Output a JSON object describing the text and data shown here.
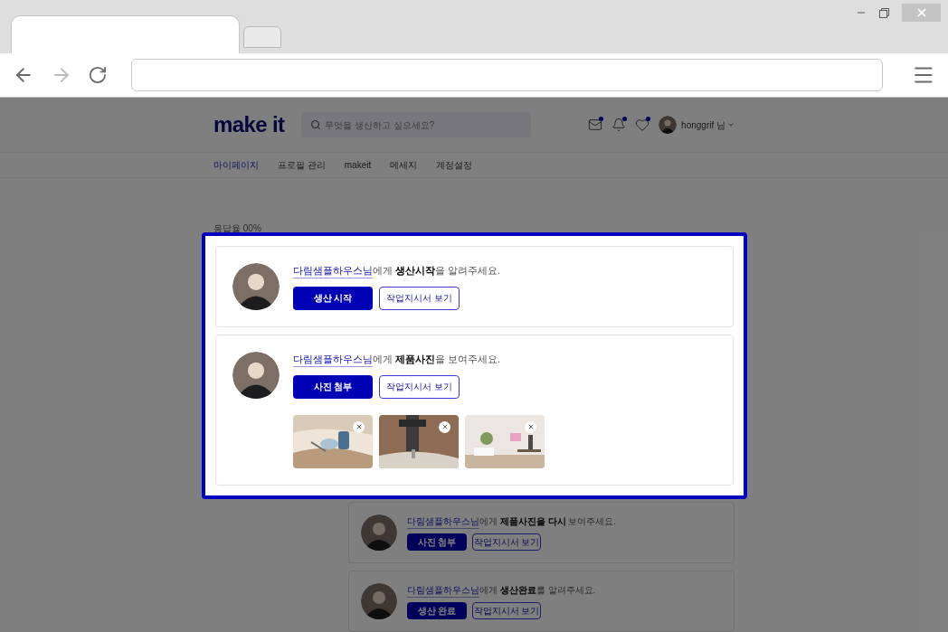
{
  "browser": {
    "tabs": [
      {
        "selected": true
      },
      {
        "selected": false
      }
    ],
    "forward_disabled": true
  },
  "page": {
    "logo": "make it",
    "search": {
      "placeholder": "무엇을 생산하고 싶으세요?"
    },
    "header_icons": [
      {
        "kind": "mail",
        "unread": true
      },
      {
        "kind": "bell",
        "unread": true
      },
      {
        "kind": "heart",
        "unread": true
      }
    ],
    "user": "honggrif 님",
    "nav": [
      {
        "label": "마이페이지",
        "selected": true
      },
      {
        "label": "프로필 관리",
        "selected": false
      },
      {
        "label": "makeit",
        "selected": false
      },
      {
        "label": "메세지",
        "selected": false
      },
      {
        "label": "계정설정",
        "selected": false
      }
    ],
    "response_rate": "응답율 00%",
    "background_tasks": [
      {
        "partner": "다림샘플하우스님",
        "message": "에게 **제품사진을 다시** 보여주세요.",
        "primary": "사진 첨부",
        "secondary": "작업지시서 보기"
      },
      {
        "partner": "다림샘플하우스님",
        "message": "에게 **생산완료**를 알려주세요.",
        "primary": "생산 완료",
        "secondary": "작업지시서 보기"
      }
    ]
  },
  "highlighted_tasks": [
    {
      "partner": "다림샘플하우스님",
      "message": "에게 **생산시작**을 알려주세요.",
      "primary": "생산 시작",
      "secondary": "작업지시서 보기"
    },
    {
      "partner": "다림샘플하우스님",
      "message": "에게 **제품사진**을 보여주세요.",
      "primary": "사진 첨부",
      "secondary": "작업지시서 보기"
    }
  ]
}
